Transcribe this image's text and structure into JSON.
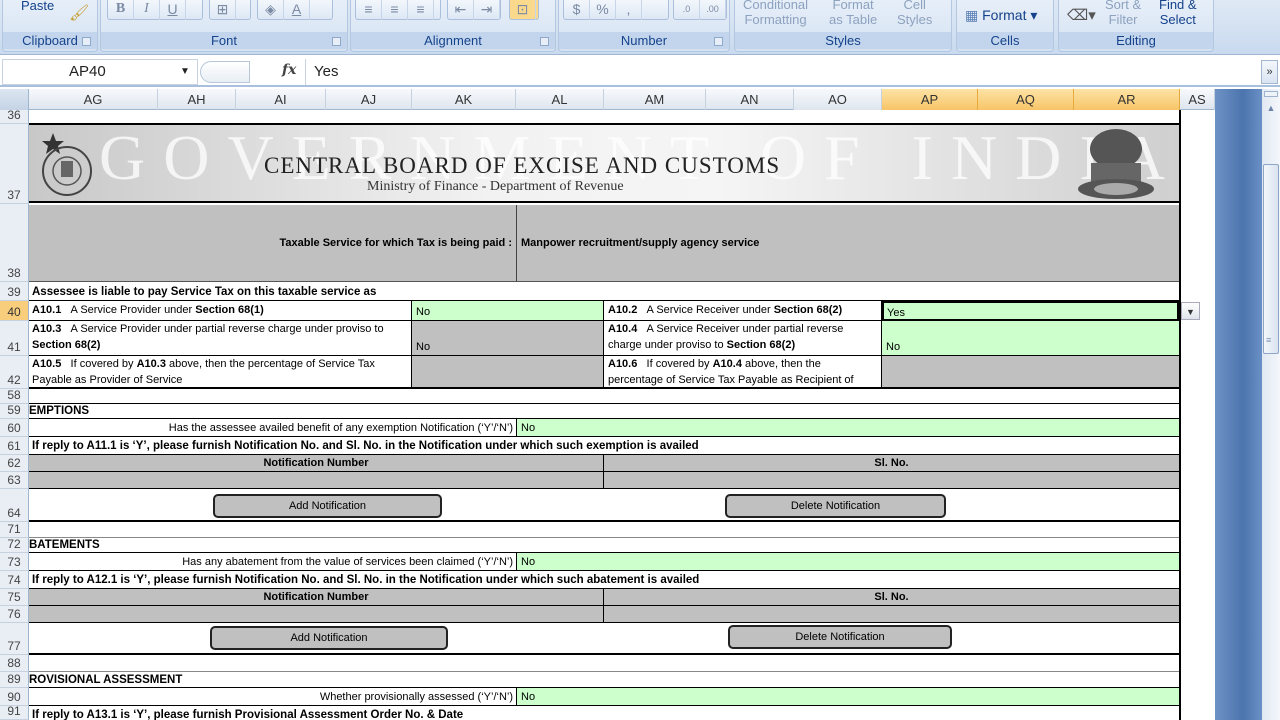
{
  "ribbon": {
    "clipboard": {
      "paste": "Paste",
      "group": "Clipboard"
    },
    "font": {
      "group": "Font",
      "bold": "B",
      "italic": "I",
      "underline": "U"
    },
    "alignment": {
      "group": "Alignment"
    },
    "number": {
      "group": "Number",
      "currency": "$",
      "percent": "%",
      "comma": ","
    },
    "styles": {
      "group": "Styles",
      "conditional": [
        "Conditional",
        "Formatting"
      ],
      "format_table": [
        "Format",
        "as Table"
      ],
      "cell_styles": [
        "Cell",
        "Styles"
      ]
    },
    "cells": {
      "group": "Cells",
      "format": "Format"
    },
    "editing": {
      "group": "Editing",
      "sort": [
        "Sort &",
        "Filter"
      ],
      "find": [
        "Find &",
        "Select"
      ]
    }
  },
  "formula_bar": {
    "name_box": "AP40",
    "fx": "fx",
    "content": "Yes"
  },
  "columns": [
    "AG",
    "AH",
    "AI",
    "AJ",
    "AK",
    "AL",
    "AM",
    "AN",
    "AO",
    "AP",
    "AQ",
    "AR",
    "AS"
  ],
  "selected_columns": [
    "AP",
    "AQ",
    "AR"
  ],
  "rows": {
    "r36": "36",
    "r37": "37",
    "r38": "38",
    "r39": "39",
    "r40": "40",
    "r41": "41",
    "r42": "42",
    "r58": "58",
    "r59": "59",
    "r60": "60",
    "r61": "61",
    "r62": "62",
    "r63": "63",
    "r64": "64",
    "r71": "71",
    "r72": "72",
    "r73": "73",
    "r74": "74",
    "r75": "75",
    "r76": "76",
    "r77": "77",
    "r88": "88",
    "r89": "89",
    "r90": "90",
    "r91": "91"
  },
  "banner": {
    "watermark": "GOVERNMENT OF INDIA",
    "title": "CENTRAL BOARD OF EXCISE AND CUSTOMS",
    "subtitle": "Ministry of Finance  - Department of Revenue"
  },
  "taxable_service": {
    "label": "Taxable Service for which Tax is being paid  :",
    "value": "Manpower recruitment/supply agency service"
  },
  "liability": {
    "heading": "Assessee is liable to pay Service Tax on this taxable service as",
    "a10_1": {
      "code": "A10.1",
      "text": "A Service Provider under ",
      "bold": "Section 68(1)",
      "value": "No"
    },
    "a10_2": {
      "code": "A10.2",
      "text": "A Service Receiver under ",
      "bold": "Section 68(2)",
      "value": "Yes"
    },
    "a10_3": {
      "code": "A10.3",
      "text": "A Service Provider  under partial reverse charge under proviso to",
      "bold": "Section 68(2)",
      "value": "No"
    },
    "a10_4": {
      "code": "A10.4",
      "text": "A Service Receiver under partial reverse",
      "text2": "charge under proviso to ",
      "bold": "Section 68(2)",
      "value": "No"
    },
    "a10_5": {
      "code": "A10.5",
      "text": "If covered by ",
      "ref": "A10.3",
      "text_b": " above, then the percentage of Service Tax",
      "text2": "Payable  as Provider of Service"
    },
    "a10_6": {
      "code": "A10.6",
      "text": "If covered by ",
      "ref": "A10.4",
      "text_b": " above, then the",
      "text2": "percentage of Service Tax Payable  as Recipient of"
    }
  },
  "exemptions": {
    "heading": "EMPTIONS",
    "question": "Has the assessee availed benefit of any exemption Notification (‘Y’/‘N’)",
    "value": "No",
    "instruction": "If reply to A11.1 is ‘Y’, please furnish Notification No. and Sl. No. in the Notification under which such exemption is availed",
    "col_notification": "Notification Number",
    "col_slno": "Sl. No.",
    "add_button": "Add Notification",
    "delete_button": "Delete Notification"
  },
  "abatements": {
    "heading": "BATEMENTS",
    "question": "Has any abatement from the value of services been claimed (‘Y’/‘N’)",
    "value": "No",
    "instruction": "If reply to A12.1 is ‘Y’, please furnish Notification No. and Sl. No. in the Notification under which such abatement is availed",
    "col_notification": "Notification Number",
    "col_slno": "Sl. No.",
    "add_button": "Add Notification",
    "delete_button": "Delete Notification"
  },
  "provisional": {
    "heading": "ROVISIONAL ASSESSMENT",
    "question": "Whether provisionally assessed (‘Y’/‘N’)",
    "value": "No",
    "instruction": "If reply to A13.1 is ‘Y’, please furnish Provisional Assessment Order No. & Date"
  }
}
